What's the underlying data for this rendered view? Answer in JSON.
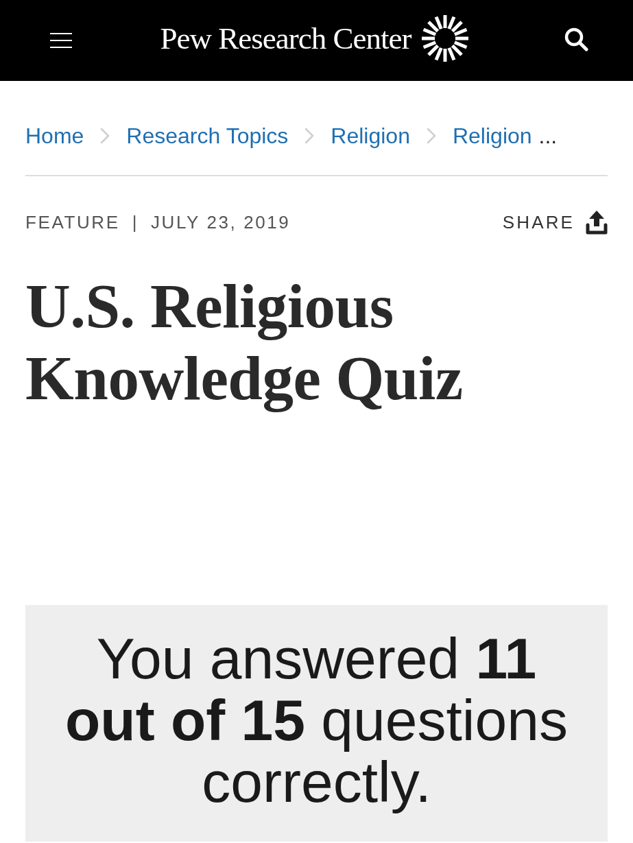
{
  "header": {
    "logo": "Pew Research Center"
  },
  "breadcrumbs": {
    "items": [
      "Home",
      "Research Topics",
      "Religion",
      "Religion"
    ],
    "overflow": "..."
  },
  "meta": {
    "type": "FEATURE",
    "separator": "|",
    "date": "JULY 23, 2019",
    "share": "SHARE"
  },
  "title": "U.S. Religious Knowledge Quiz",
  "result": "You answered **11 out of 15** questions correctly."
}
